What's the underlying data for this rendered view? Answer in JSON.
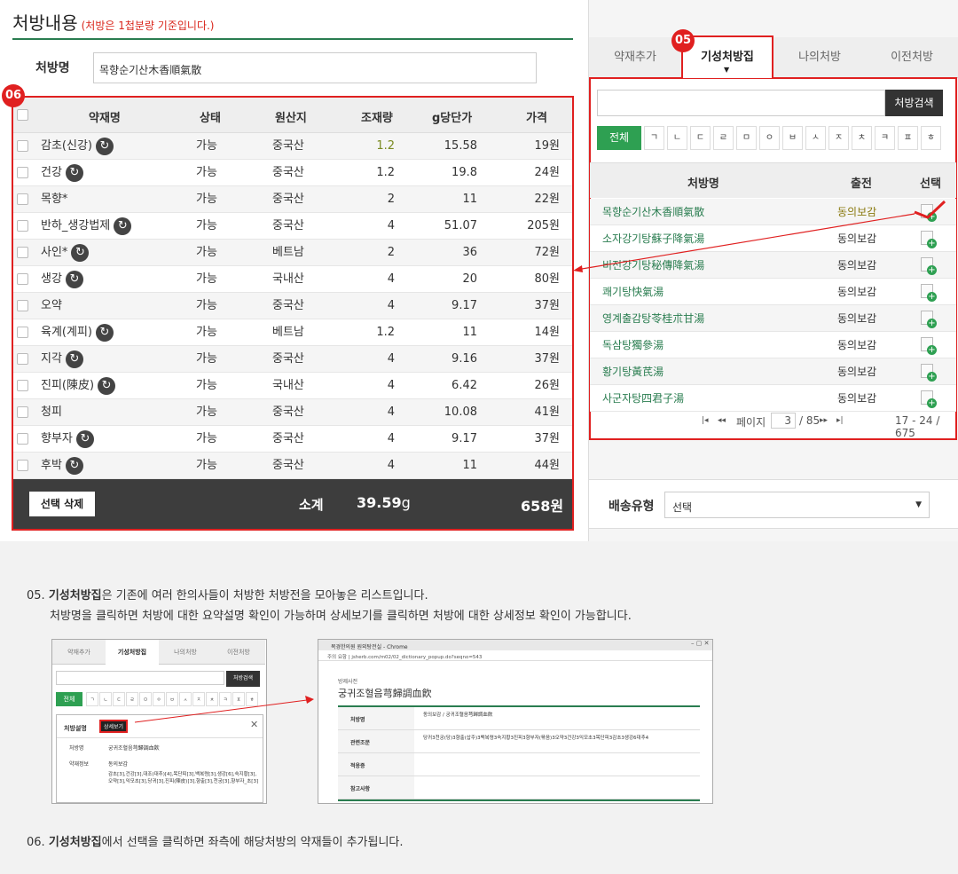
{
  "left": {
    "title": "처방내용",
    "subtitle": "(처방은 1첩분량 기준입니다.)",
    "rx_name_label": "처방명",
    "rx_name_value": "목향순기산木香順氣散",
    "badge": "06",
    "headers": [
      "약재명",
      "상태",
      "원산지",
      "조재량",
      "g당단가",
      "가격"
    ],
    "rows": [
      {
        "name": "감초(신강)",
        "sync": true,
        "status": "가능",
        "origin": "중국산",
        "qty": "1.2",
        "unit": "15.58",
        "price": "19원",
        "qty_green": true
      },
      {
        "name": "건강",
        "sync": true,
        "status": "가능",
        "origin": "중국산",
        "qty": "1.2",
        "unit": "19.8",
        "price": "24원"
      },
      {
        "name": "목향*",
        "sync": false,
        "status": "가능",
        "origin": "중국산",
        "qty": "2",
        "unit": "11",
        "price": "22원"
      },
      {
        "name": "반하_생강법제",
        "sync": true,
        "status": "가능",
        "origin": "중국산",
        "qty": "4",
        "unit": "51.07",
        "price": "205원"
      },
      {
        "name": "사인*",
        "sync": true,
        "status": "가능",
        "origin": "베트남",
        "qty": "2",
        "unit": "36",
        "price": "72원"
      },
      {
        "name": "생강",
        "sync": true,
        "status": "가능",
        "origin": "국내산",
        "qty": "4",
        "unit": "20",
        "price": "80원"
      },
      {
        "name": "오약",
        "sync": false,
        "status": "가능",
        "origin": "중국산",
        "qty": "4",
        "unit": "9.17",
        "price": "37원"
      },
      {
        "name": "육계(계피)",
        "sync": true,
        "status": "가능",
        "origin": "베트남",
        "qty": "1.2",
        "unit": "11",
        "price": "14원"
      },
      {
        "name": "지각",
        "sync": true,
        "status": "가능",
        "origin": "중국산",
        "qty": "4",
        "unit": "9.16",
        "price": "37원"
      },
      {
        "name": "진피(陳皮)",
        "sync": true,
        "status": "가능",
        "origin": "국내산",
        "qty": "4",
        "unit": "6.42",
        "price": "26원"
      },
      {
        "name": "청피",
        "sync": false,
        "status": "가능",
        "origin": "중국산",
        "qty": "4",
        "unit": "10.08",
        "price": "41원"
      },
      {
        "name": "향부자",
        "sync": true,
        "status": "가능",
        "origin": "중국산",
        "qty": "4",
        "unit": "9.17",
        "price": "37원"
      },
      {
        "name": "후박",
        "sync": true,
        "status": "가능",
        "origin": "중국산",
        "qty": "4",
        "unit": "11",
        "price": "44원"
      }
    ],
    "footer": {
      "delete_label": "선택 삭제",
      "subtotal_label": "소계",
      "weight": "39.59",
      "weight_unit": "g",
      "total": "658원"
    }
  },
  "right": {
    "badge": "05",
    "tabs": [
      "약재추가",
      "기성처방집",
      "나의처방",
      "이전처방"
    ],
    "search_button": "처방검색",
    "consonants": [
      "전체",
      "ㄱ",
      "ㄴ",
      "ㄷ",
      "ㄹ",
      "ㅁ",
      "ㅇ",
      "ㅂ",
      "ㅅ",
      "ㅈ",
      "ㅊ",
      "ㅋ",
      "ㅍ",
      "ㅎ"
    ],
    "headers": [
      "처방명",
      "출전",
      "선택"
    ],
    "rows": [
      {
        "name": "목향순기산木香順氣散",
        "source": "동의보감",
        "highlight": true
      },
      {
        "name": "소자강기탕蘇子降氣湯",
        "source": "동의보감"
      },
      {
        "name": "비전강기탕秘傳降氣湯",
        "source": "동의보감"
      },
      {
        "name": "쾌기탕快氣湯",
        "source": "동의보감"
      },
      {
        "name": "영계출감탕苓桂朮甘湯",
        "source": "동의보감"
      },
      {
        "name": "독삼탕獨參湯",
        "source": "동의보감"
      },
      {
        "name": "황기탕黃芪湯",
        "source": "동의보감"
      },
      {
        "name": "사군자탕四君子湯",
        "source": "동의보감"
      }
    ],
    "pager": {
      "page_label": "페이지",
      "page": "3",
      "total_pages": "/ 85",
      "range": "17 - 24 / 675",
      "first": "|◂",
      "prev": "◂◂",
      "next": "▸▸",
      "last": "▸|"
    },
    "delivery_label": "배송유형",
    "delivery_value": "선택"
  },
  "desc": {
    "d05_num": "05.",
    "d05_bold": "기성처방집",
    "d05_rest": "은 기존에 여러 한의사들이 처방한 처방전을 모아놓은 리스트입니다.",
    "d05_line2": "처방명을 클릭하면 처방에 대한 요약설명 확인이 가능하며 상세보기를 클릭하면 처방에 대한 상세정보 확인이 가능합니다.",
    "d06_num": "06.",
    "d06_bold": "기성처방집",
    "d06_rest": "에서 선택을 클릭하면 좌측에 해당처방의 약재들이 추가됩니다."
  },
  "shot1": {
    "tabs": [
      "약재추가",
      "기성처방집",
      "나의처방",
      "이전처방"
    ],
    "search_button": "처방검색",
    "all": "전체",
    "consonants": [
      "ㄱ",
      "ㄴ",
      "ㄷ",
      "ㄹ",
      "ㅁ",
      "ㅇ",
      "ㅂ",
      "ㅅ",
      "ㅈ",
      "ㅊ",
      "ㅋ",
      "ㅍ",
      "ㅎ"
    ],
    "popup_title": "처방설명",
    "detail_button": "상세보기",
    "rx_label": "처방명",
    "rx_value": "궁귀조혈음芎歸調血飮",
    "info_label": "약재정보",
    "info_source": "동의보감",
    "info_text": "감초[3],건강[3],대조(대추)[4],목단피[3],백복령[3],생강[6],숙지황[3],오약[3],익모초[3],당귀[3],진피(陳皮)[3],향출[3],천궁[3],향부자_초[3]"
  },
  "shot2": {
    "window_title": "복경한의원 원외탕전실 - Chrome",
    "url": "주의 요함 | jsherb.com/m02/02_dictionary_popup.do?seqno=543",
    "section": "방제사전",
    "title": "궁귀조혈음芎歸調血飮",
    "rows": [
      {
        "label": "처방명",
        "value": "동의보감 / 궁귀조혈음芎歸調血飮"
      },
      {
        "label": "관련조문",
        "value": "당귀3천궁(당)3향출(삽주)3백복령3숙지황3진피3향부자(볶음)3오약3건강3익모초3목단피3감초3생강6대추4"
      },
      {
        "label": "적응증",
        "value": ""
      },
      {
        "label": "참고사항",
        "value": ""
      }
    ]
  }
}
